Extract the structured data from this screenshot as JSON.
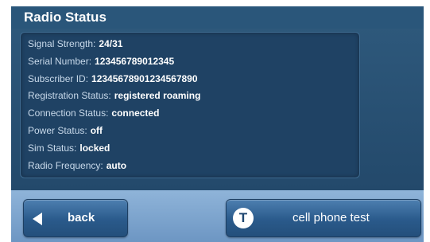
{
  "header": {
    "title": "Radio Status"
  },
  "status": {
    "items": [
      {
        "label": "Signal Strength:",
        "value": "24/31"
      },
      {
        "label": "Serial Number:",
        "value": "123456789012345"
      },
      {
        "label": "Subscriber ID:",
        "value": "12345678901234567890"
      },
      {
        "label": "Registration Status:",
        "value": "registered roaming"
      },
      {
        "label": "Connection Status:",
        "value": "connected"
      },
      {
        "label": "Power Status:",
        "value": "off"
      },
      {
        "label": "Sim Status:",
        "value": "locked"
      },
      {
        "label": "Radio Frequency:",
        "value": "auto"
      }
    ]
  },
  "buttons": {
    "back": {
      "label": "back",
      "icon": "arrow-left-icon"
    },
    "cell_phone_test": {
      "label": "cell phone test",
      "icon": "t-circle-icon",
      "icon_glyph": "T"
    }
  },
  "colors": {
    "panel": "#2a567a",
    "info_box": "#1f4264",
    "bottom_bar": "#7fa6cf",
    "button": "#2a5a8b"
  }
}
